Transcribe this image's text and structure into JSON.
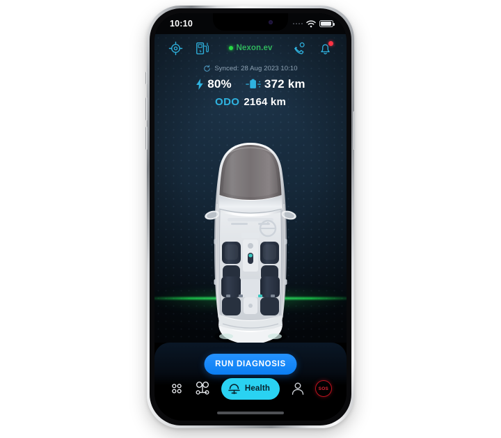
{
  "device": {
    "name": "smartphone-mockup",
    "frame_color": "#c8cbcf"
  },
  "status_bar": {
    "time": "10:10",
    "signal_icon": "signal-dots-icon",
    "wifi_icon": "wifi-icon",
    "battery_icon": "battery-icon",
    "battery_level_percent": 80
  },
  "top_nav": {
    "locate_icon": "crosshair-locate-icon",
    "charging_icon": "ev-charging-station-icon",
    "call_icon": "phone-call-icon",
    "bell_icon": "notification-bell-icon",
    "bell_has_badge": true,
    "vehicle": {
      "name": "Nexon.ev",
      "status_dot_color": "#27d944",
      "name_color": "#2fb45c"
    }
  },
  "sync": {
    "icon": "sync-refresh-icon",
    "text": "Synced: 28 Aug 2023 10:10"
  },
  "stats": {
    "battery": {
      "icon": "lightning-bolt-icon",
      "value": "80%"
    },
    "range": {
      "icon": "ev-battery-range-icon",
      "value": "372 km"
    },
    "odometer": {
      "label": "ODO",
      "value": "2164 km",
      "label_color": "#2fb3e0"
    }
  },
  "vehicle_view": {
    "illustration": "car-top-down-illustration",
    "description": "Top-down view of white electric SUV with four dark navy seats",
    "body_color": "#f2f3f5",
    "seat_color": "#2b3444",
    "glow_color": "#1eff5a",
    "background_color": "#16293a"
  },
  "action": {
    "run_diagnosis_label": "RUN DIAGNOSIS",
    "button_color": "#0b7ef2"
  },
  "tab_bar": {
    "active_color": "#2ad2f2",
    "items": [
      {
        "id": "dashboard",
        "label": "",
        "icon": "grid-dots-icon",
        "active": false
      },
      {
        "id": "connect",
        "label": "",
        "icon": "share-network-icon",
        "active": false
      },
      {
        "id": "health",
        "label": "Health",
        "icon": "health-gauge-icon",
        "active": true
      },
      {
        "id": "profile",
        "label": "",
        "icon": "person-icon",
        "active": false
      },
      {
        "id": "sos",
        "label": "SOS",
        "icon": "sos-emergency-icon",
        "active": false
      }
    ]
  }
}
